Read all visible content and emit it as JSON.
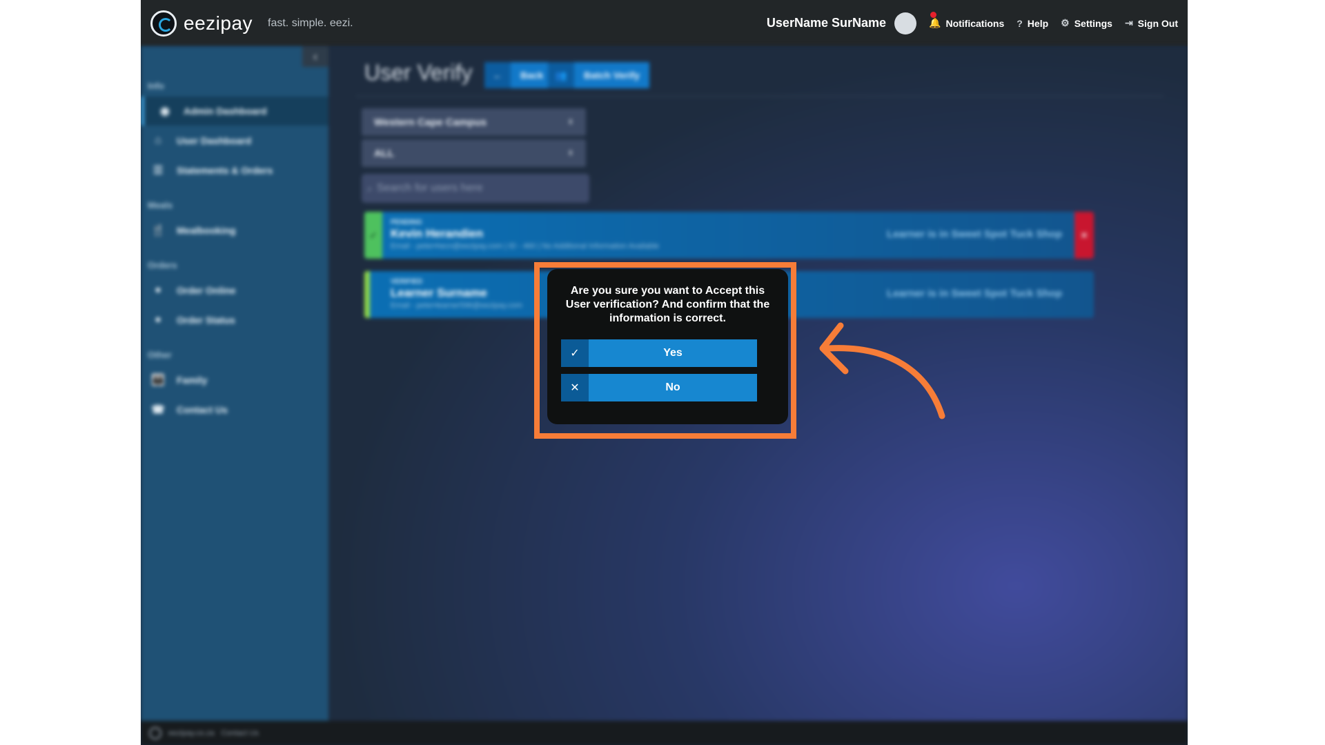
{
  "brand": {
    "name": "eezipay",
    "tagline": "fast. simple. eezi."
  },
  "header": {
    "user_name": "UserName SurName",
    "notifications_label": "Notifications",
    "help_label": "Help",
    "settings_label": "Settings",
    "sign_out_label": "Sign Out"
  },
  "sidebar": {
    "collapse_glyph": "‹",
    "sections": {
      "info": "Info",
      "meals": "Meals",
      "orders": "Orders",
      "other": "Other"
    },
    "items": {
      "admin_dashboard": "Admin Dashboard",
      "user_dashboard": "User Dashboard",
      "statements": "Statements & Orders",
      "mealbooking": "Mealbooking",
      "order_online": "Order Online",
      "order_status": "Order Status",
      "family": "Family",
      "contact_us": "Contact Us"
    },
    "active_item": "Admin Dashboard"
  },
  "page": {
    "title": "User Verify",
    "back_label": "Back",
    "batch_verify_label": "Batch Verify",
    "campus_select": "Western Cape Campus",
    "status_select": "ALL",
    "search_placeholder": "Search for users here"
  },
  "cards": [
    {
      "status": "PENDING",
      "name": "Kevin Herandien",
      "detail": "Email - peter•hecn@eezipay.com | ID - 460 | No Additional Information Available",
      "location": "Learner is in Sweet Spot Tuck Shop"
    },
    {
      "status": "VERIFIED",
      "name": "Learner Surname",
      "detail": "Email - peter•learner596@eezipay.com",
      "location": "Learner is in Sweet Spot Tuck Shop"
    }
  ],
  "modal": {
    "message": "Are you sure you want to Accept this User verification? And confirm that the information is correct.",
    "yes_label": "Yes",
    "no_label": "No"
  },
  "footer": {
    "site": "eezipay.co.za",
    "contact": "Contact Us"
  },
  "colors": {
    "highlight": "#f77d38",
    "primary_button": "#1787d0",
    "sidebar": "#1f5175",
    "topbar": "#222628"
  }
}
